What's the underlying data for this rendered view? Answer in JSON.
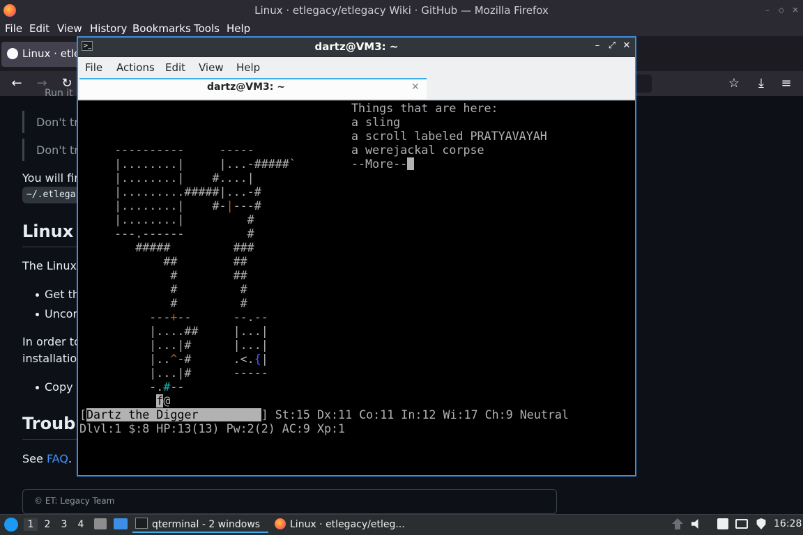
{
  "firefox": {
    "window_title": "Linux · etlegacy/etlegacy Wiki · GitHub — Mozilla Firefox",
    "menu": [
      "File",
      "Edit",
      "View",
      "History",
      "Bookmarks",
      "Tools",
      "Help"
    ],
    "tab_label": "Linux · etleg",
    "win_controls": [
      "–",
      "◇",
      "✕"
    ],
    "nav_icons": [
      "←",
      "→",
      "↻"
    ],
    "toolbar_icons": [
      "☆",
      "⤓",
      "≡"
    ]
  },
  "page": {
    "list_frag": "Run it",
    "quote1": "Don't try",
    "quote2": "Don't try",
    "para1": "You will find",
    "code": "~/.etlega",
    "heading1": "Linux A",
    "para2": "The Linux a",
    "bullet1": "Get the",
    "bullet2": "Uncom",
    "para3a": "In order to",
    "para3b": "installation.",
    "bullet3": "Copy t",
    "heading2": "Trouble",
    "see_text": "See ",
    "faq_link": "FAQ",
    "faq_dot": ".",
    "footer": "© ET: Legacy Team",
    "link_color": "#4493f8"
  },
  "qterminal": {
    "window_title": "dartz@VM3: ~",
    "icon": ">_",
    "controls": [
      "–",
      "⤢",
      "✕"
    ],
    "menu": [
      "File",
      "Actions",
      "Edit",
      "View",
      "Help"
    ],
    "tab_label": "dartz@VM3: ~",
    "tab_close": "✕",
    "accent": "#3daee9",
    "screen": {
      "here_title": "Things that are here:",
      "items": [
        "a sling",
        "a scroll labeled PRATYAVAYAH",
        "a werejackal corpse"
      ],
      "more": "--More--",
      "map_rows": [
        [
          {
            "t": "                                                  "
          }
        ],
        [
          {
            "t": "                                                  "
          }
        ],
        [
          {
            "t": "                                                  "
          }
        ],
        [
          {
            "t": "     ----------     -----"
          }
        ],
        [
          {
            "t": "     |........|     |...-#####`"
          }
        ],
        [
          {
            "t": "     |........|    #....|"
          }
        ],
        [
          {
            "t": "     |.........#####|...-#"
          }
        ],
        [
          {
            "t": "     |........|    #-"
          },
          {
            "t": "|",
            "c": "c-or"
          },
          {
            "t": "---#"
          }
        ],
        [
          {
            "t": "     |........|         #"
          }
        ],
        [
          {
            "t": "     ---.------         #"
          }
        ],
        [
          {
            "t": "        #####         ###"
          }
        ],
        [
          {
            "t": "            ##        ##"
          }
        ],
        [
          {
            "t": "             #        ##"
          }
        ],
        [
          {
            "t": "             #         #"
          }
        ],
        [
          {
            "t": "             #         #"
          }
        ],
        [
          {
            "t": "          ---"
          },
          {
            "t": "+",
            "c": "c-or"
          },
          {
            "t": "--      --.--"
          }
        ],
        [
          {
            "t": "          |....##     |...|"
          }
        ],
        [
          {
            "t": "          |...|#      |...|"
          }
        ],
        [
          {
            "t": "          |.."
          },
          {
            "t": "^",
            "c": "c-or"
          },
          {
            "t": "-#      .<."
          },
          {
            "t": "{",
            "c": "c-bl"
          },
          {
            "t": "|"
          }
        ],
        [
          {
            "t": "          |...|#      -----"
          }
        ],
        [
          {
            "t": "          -."
          },
          {
            "t": "#",
            "c": "c-cy"
          },
          {
            "t": "--"
          }
        ],
        [
          {
            "t": "           "
          },
          {
            "t": "f",
            "c": "c-hl"
          },
          {
            "t": "@"
          }
        ]
      ],
      "status1_open": "[",
      "status1_name": "Dartz the Digger         ",
      "status1_rest": "] St:15 Dx:11 Co:11 In:12 Wi:17 Ch:9 Neutral",
      "status2": "Dlvl:1 $:8 HP:13(13) Pw:2(2) AC:9 Xp:1"
    }
  },
  "taskbar": {
    "workspaces": [
      "1",
      "2",
      "3",
      "4"
    ],
    "task_terminal": "qterminal - 2 windows",
    "task_firefox": "Linux · etlegacy/etleg...",
    "clock": "16:28"
  }
}
